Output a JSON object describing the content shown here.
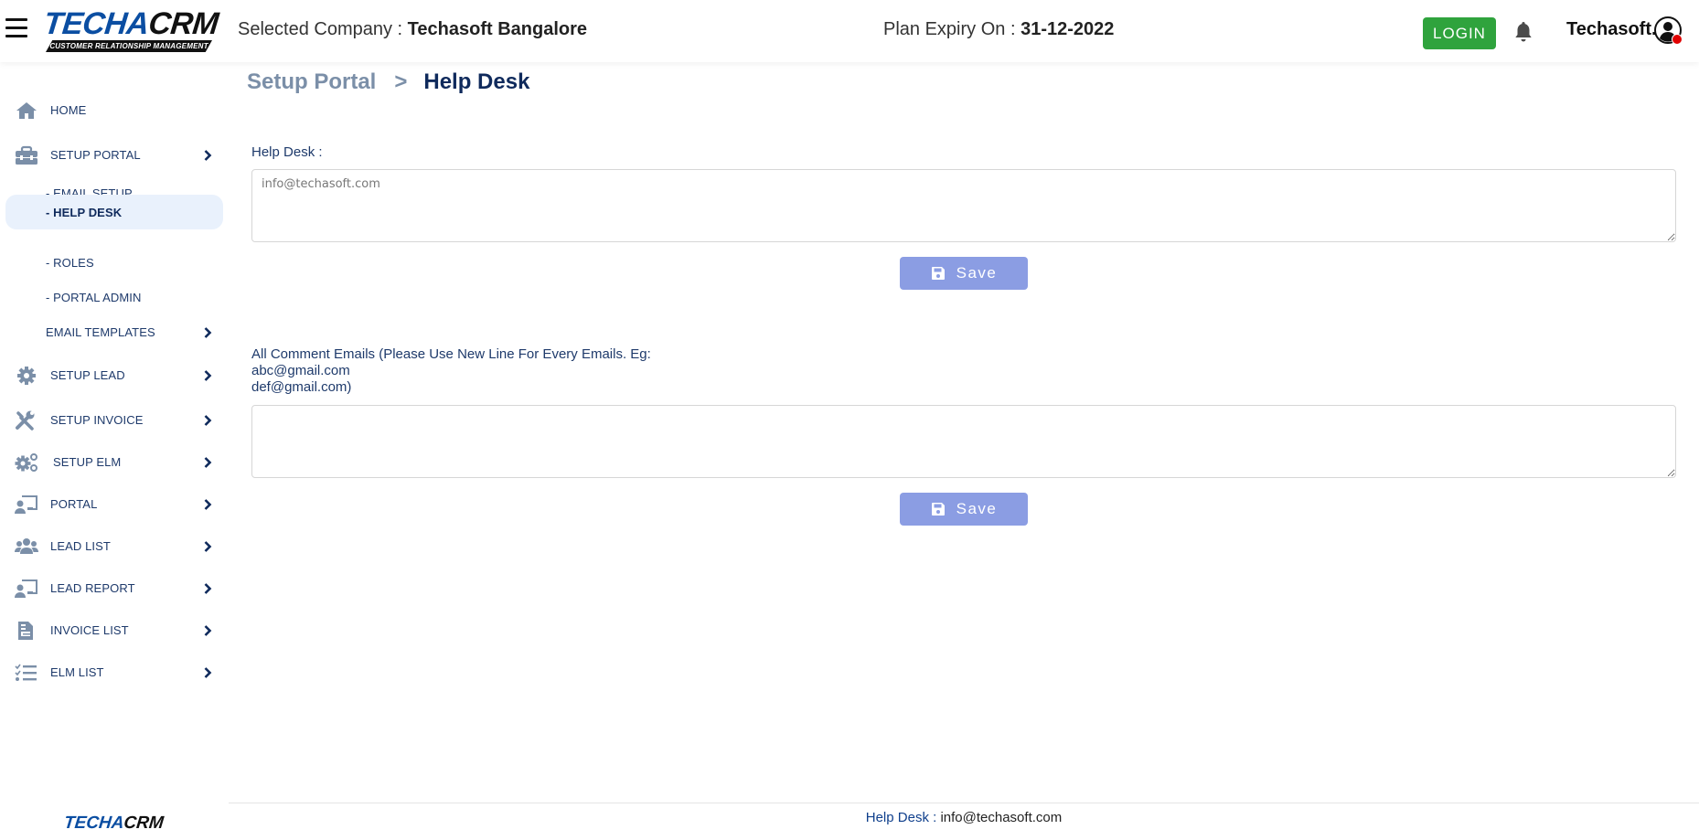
{
  "header": {
    "logo": {
      "part1": "TECHA",
      "part2": "CRM",
      "tagline": "CUSTOMER RELATIONSHIP MANAGEMENT"
    },
    "selected_company_label": "Selected Company :",
    "selected_company_value": "Techasoft Bangalore",
    "plan_expiry_label": "Plan Expiry On :",
    "plan_expiry_value": "31-12-2022",
    "login_label": "LOGIN",
    "username": "Techasoft.",
    "icons": {
      "menu": "hamburger-icon",
      "notifications": "bell-icon",
      "avatar": "user-circle-icon"
    }
  },
  "sidebar": {
    "items": [
      {
        "label": "HOME",
        "icon": "home-icon",
        "chevron": false
      },
      {
        "label": "SETUP PORTAL",
        "icon": "toolbox-icon",
        "chevron": true
      },
      {
        "label": "SETUP LEAD",
        "icon": "gear-icon",
        "chevron": true
      },
      {
        "label": "SETUP INVOICE",
        "icon": "tools-icon",
        "chevron": true
      },
      {
        "label": "SETUP ELM",
        "icon": "gears-icon",
        "chevron": true
      },
      {
        "label": "PORTAL",
        "icon": "user-screen-icon",
        "chevron": true
      },
      {
        "label": "LEAD LIST",
        "icon": "users-icon",
        "chevron": true
      },
      {
        "label": "LEAD REPORT",
        "icon": "user-screen-icon",
        "chevron": true
      },
      {
        "label": "INVOICE LIST",
        "icon": "document-icon",
        "chevron": true
      },
      {
        "label": "ELM LIST",
        "icon": "checklist-icon",
        "chevron": true
      }
    ],
    "sub_items": [
      {
        "label": "- EMAIL SETUP",
        "active": false
      },
      {
        "label": "- HELP DESK",
        "active": true
      },
      {
        "label": "- ROLES",
        "active": false
      },
      {
        "label": "- PORTAL ADMIN",
        "active": false
      },
      {
        "label": "EMAIL TEMPLATES",
        "active": false,
        "chevron": true
      }
    ],
    "footer_logo": {
      "part1": "TECHA",
      "part2": "CRM"
    }
  },
  "main": {
    "breadcrumb": {
      "parent": "Setup Portal",
      "separator": ">",
      "current": "Help Desk"
    },
    "help_desk": {
      "label": "Help Desk :",
      "value": "",
      "placeholder": "info@techasoft.com",
      "save_label": "Save"
    },
    "comment_emails": {
      "label_line1": "All Comment Emails (Please Use New Line For Every Emails. Eg:",
      "label_line2": "abc@gmail.com",
      "label_line3": "def@gmail.com)",
      "value": "",
      "placeholder": "",
      "save_label": "Save"
    }
  },
  "footer": {
    "label": "Help Desk :",
    "value": "info@techasoft.com"
  },
  "colors": {
    "brand_blue": "#0b4ea2",
    "nav_text": "#1e3a6b",
    "login_green": "#2fa33d",
    "save_button": "#8b9de3",
    "active_item_bg": "#e9f1fc",
    "avatar_status": "#e00000"
  }
}
